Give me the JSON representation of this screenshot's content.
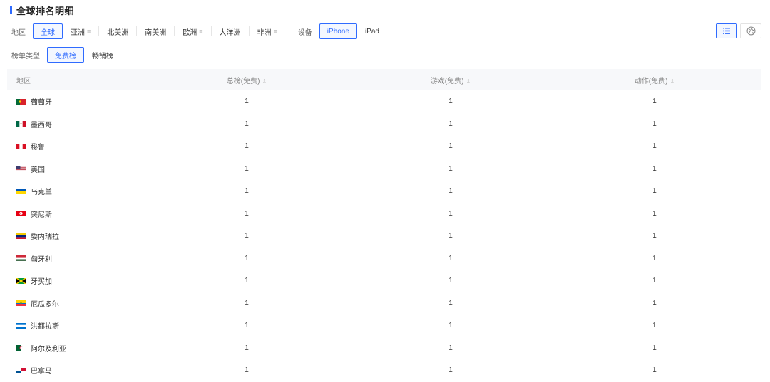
{
  "title": "全球排名明细",
  "filters": {
    "region_label": "地区",
    "regions": [
      {
        "label": "全球",
        "active": true,
        "menu": false
      },
      {
        "label": "亚洲",
        "active": false,
        "menu": true
      },
      {
        "label": "北美洲",
        "active": false,
        "menu": false
      },
      {
        "label": "南美洲",
        "active": false,
        "menu": false
      },
      {
        "label": "欧洲",
        "active": false,
        "menu": true
      },
      {
        "label": "大洋洲",
        "active": false,
        "menu": false
      },
      {
        "label": "非洲",
        "active": false,
        "menu": true
      }
    ],
    "device_label": "设备",
    "devices": [
      {
        "label": "iPhone",
        "active": true
      },
      {
        "label": "iPad",
        "active": false
      }
    ],
    "list_type_label": "榜单类型",
    "list_types": [
      {
        "label": "免费榜",
        "active": true
      },
      {
        "label": "畅销榜",
        "active": false
      }
    ]
  },
  "view_buttons": [
    {
      "icon": "list-view-icon",
      "active": true
    },
    {
      "icon": "globe-icon",
      "active": false
    }
  ],
  "table": {
    "headers": [
      "地区",
      "总榜(免费)",
      "游戏(免费)",
      "动作(免费)"
    ],
    "rows": [
      {
        "country": "葡萄牙",
        "flag": "portugal",
        "values": [
          "1",
          "1",
          "1"
        ]
      },
      {
        "country": "墨西哥",
        "flag": "mexico",
        "values": [
          "1",
          "1",
          "1"
        ]
      },
      {
        "country": "秘鲁",
        "flag": "peru",
        "values": [
          "1",
          "1",
          "1"
        ]
      },
      {
        "country": "美国",
        "flag": "usa",
        "values": [
          "1",
          "1",
          "1"
        ]
      },
      {
        "country": "乌克兰",
        "flag": "ukraine",
        "values": [
          "1",
          "1",
          "1"
        ]
      },
      {
        "country": "突尼斯",
        "flag": "tunisia",
        "values": [
          "1",
          "1",
          "1"
        ]
      },
      {
        "country": "委内瑞拉",
        "flag": "venezuela",
        "values": [
          "1",
          "1",
          "1"
        ]
      },
      {
        "country": "匈牙利",
        "flag": "hungary",
        "values": [
          "1",
          "1",
          "1"
        ]
      },
      {
        "country": "牙买加",
        "flag": "jamaica",
        "values": [
          "1",
          "1",
          "1"
        ]
      },
      {
        "country": "厄瓜多尔",
        "flag": "ecuador",
        "values": [
          "1",
          "1",
          "1"
        ]
      },
      {
        "country": "洪都拉斯",
        "flag": "honduras",
        "values": [
          "1",
          "1",
          "1"
        ]
      },
      {
        "country": "阿尔及利亚",
        "flag": "algeria",
        "values": [
          "1",
          "1",
          "1"
        ]
      },
      {
        "country": "巴拿马",
        "flag": "panama",
        "values": [
          "1",
          "1",
          "1"
        ]
      }
    ]
  },
  "colors": {
    "accent": "#2f6bff"
  }
}
